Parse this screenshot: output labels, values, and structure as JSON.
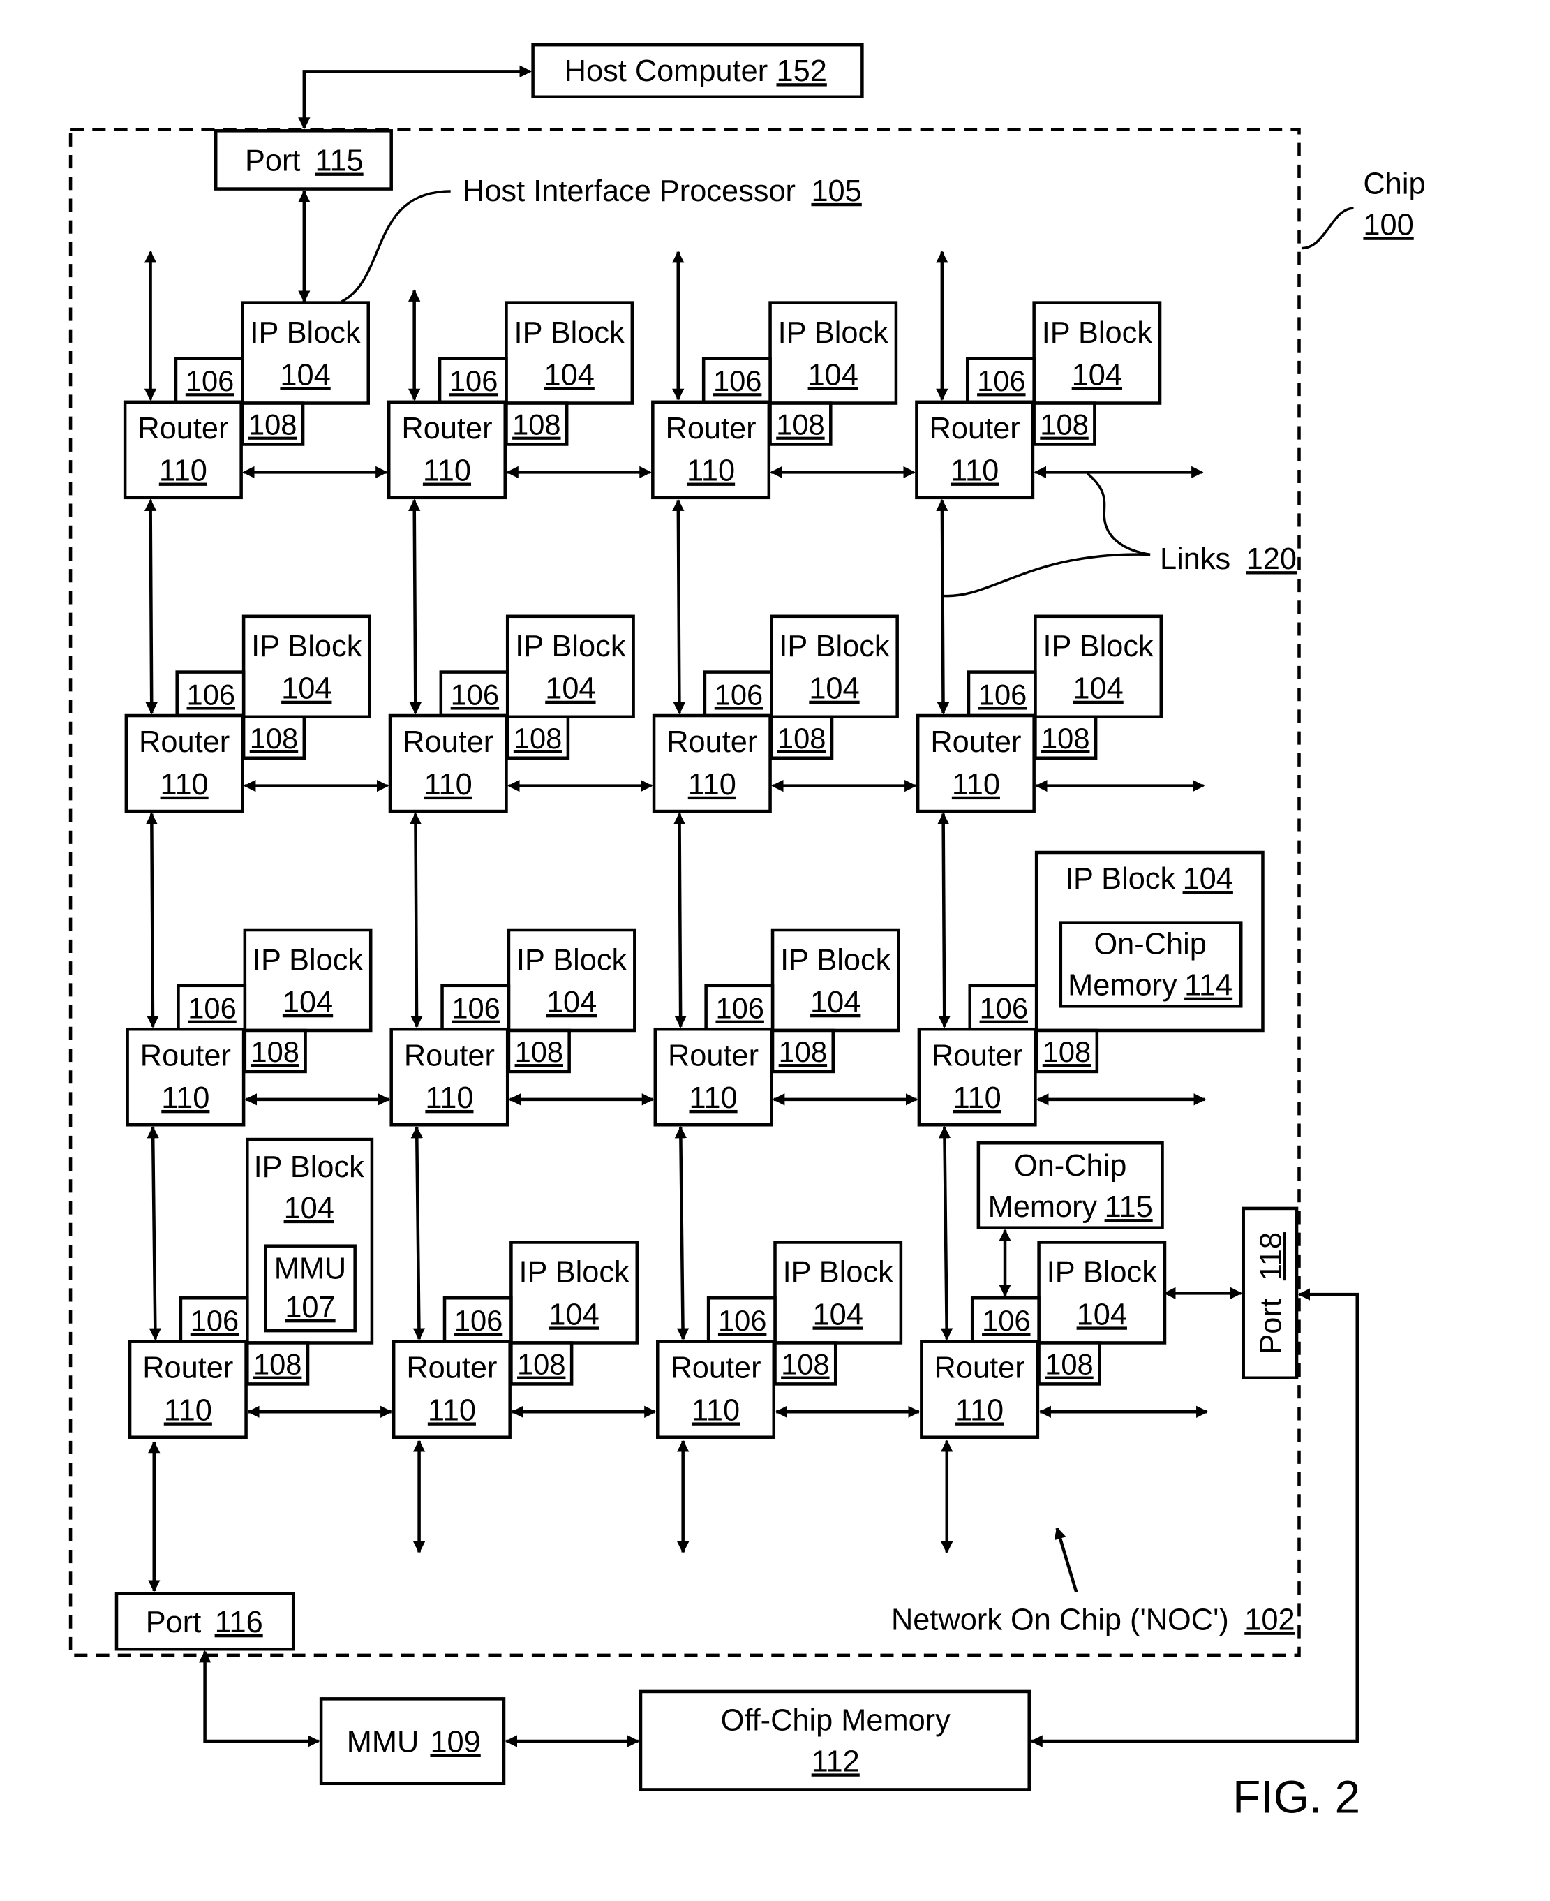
{
  "figure": {
    "label": "FIG. 2",
    "chip": {
      "name": "Chip",
      "ref": "100"
    },
    "noc": {
      "name": "Network On Chip ('NOC')",
      "ref": "102"
    },
    "links": {
      "name": "Links",
      "ref": "120"
    },
    "host_interface_processor": {
      "name": "Host Interface Processor",
      "ref": "105"
    }
  },
  "external": {
    "host_computer": {
      "name": "Host Computer",
      "ref": "152"
    },
    "mmu_109": {
      "name": "MMU",
      "ref": "109"
    },
    "off_chip_memory": {
      "name": "Off-Chip Memory",
      "ref": "112"
    }
  },
  "ports": {
    "port_115": {
      "name": "Port",
      "ref": "115"
    },
    "port_116": {
      "name": "Port",
      "ref": "116"
    },
    "port_118": {
      "name": "Port",
      "ref": "118"
    }
  },
  "node": {
    "router_name": "Router",
    "router_ref": "110",
    "ip_block_name": "IP Block",
    "ip_block_ref": "104",
    "memory_comm_ctrl_ref": "106",
    "network_iface_ctrl_ref": "108"
  },
  "special": {
    "on_chip_memory_114": {
      "line1": "On-Chip",
      "line2": "Memory",
      "ref": "114"
    },
    "on_chip_memory_115": {
      "line1": "On-Chip",
      "line2": "Memory",
      "ref": "115"
    },
    "mmu_107": {
      "name": "MMU",
      "ref": "107"
    }
  },
  "grid": {
    "rows": 4,
    "cols": 4
  }
}
